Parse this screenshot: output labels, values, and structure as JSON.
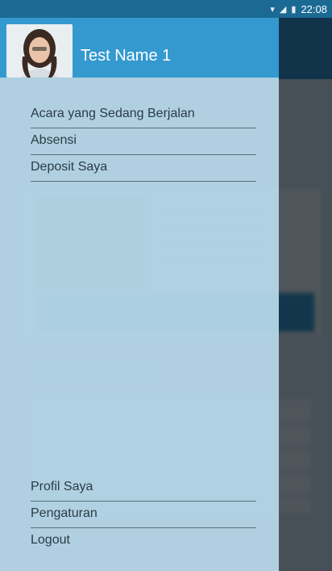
{
  "status_bar": {
    "time": "22:08",
    "icons": [
      "wifi-icon",
      "signal-icon",
      "battery-icon"
    ]
  },
  "drawer": {
    "user": {
      "name": "Test Name 1"
    },
    "menu_top": [
      {
        "label": "Acara yang Sedang Berjalan"
      },
      {
        "label": "Absensi"
      },
      {
        "label": "Deposit Saya"
      }
    ],
    "menu_bottom": [
      {
        "label": "Profil Saya"
      },
      {
        "label": "Pengaturan"
      },
      {
        "label": "Logout"
      }
    ]
  },
  "colors": {
    "header": "#3499cf",
    "drawer_bg": "#b8daec",
    "status_bar": "#1b6a93",
    "text": "#2a3b46"
  }
}
